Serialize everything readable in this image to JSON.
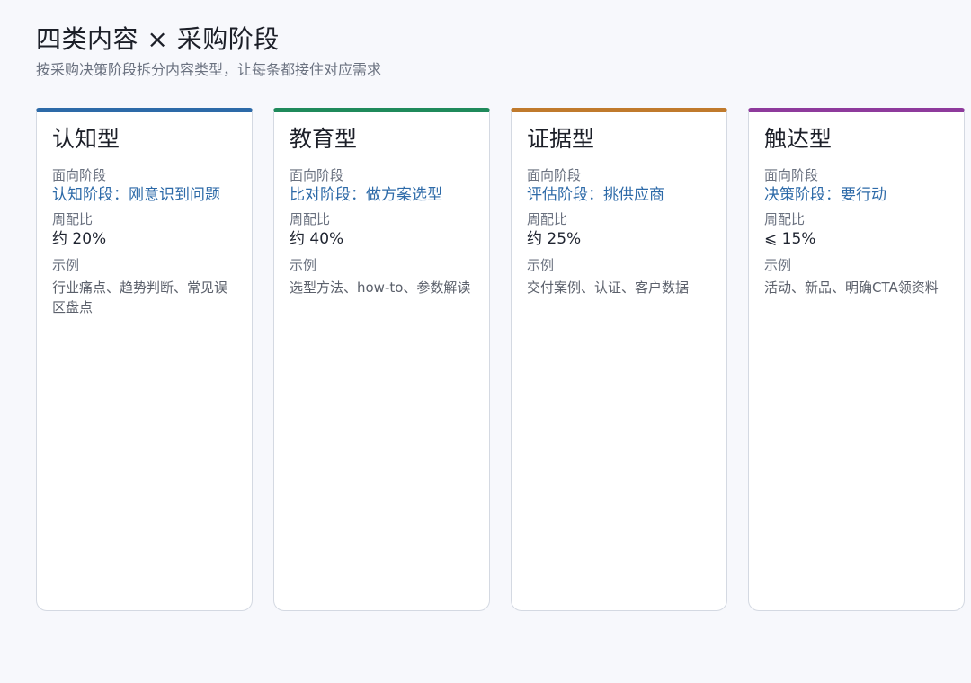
{
  "header": {
    "title": "四类内容 × 采购阶段",
    "subtitle": "按采购决策阶段拆分内容类型，让每条都接住对应需求"
  },
  "labels": {
    "stage": "面向阶段",
    "ratio": "周配比",
    "example": "示例"
  },
  "cards": [
    {
      "title": "认知型",
      "stage": "认知阶段：刚意识到问题",
      "ratio": "约 20%",
      "example": "行业痛点、趋势判断、常见误区盘点",
      "accent": "#2d6aa8",
      "stage_color": "#2d6aa8"
    },
    {
      "title": "教育型",
      "stage": "比对阶段：做方案选型",
      "ratio": "约 40%",
      "example": "选型方法、how-to、参数解读",
      "accent": "#1f8a5b",
      "stage_color": "#2d6aa8"
    },
    {
      "title": "证据型",
      "stage": "评估阶段：挑供应商",
      "ratio": "约 25%",
      "example": "交付案例、认证、客户数据",
      "accent": "#c07a2c",
      "stage_color": "#2d6aa8"
    },
    {
      "title": "触达型",
      "stage": "决策阶段：要行动",
      "ratio": "⩽ 15%",
      "example": "活动、新品、明确CTA领资料",
      "accent": "#8e3a9c",
      "stage_color": "#2d6aa8"
    }
  ]
}
